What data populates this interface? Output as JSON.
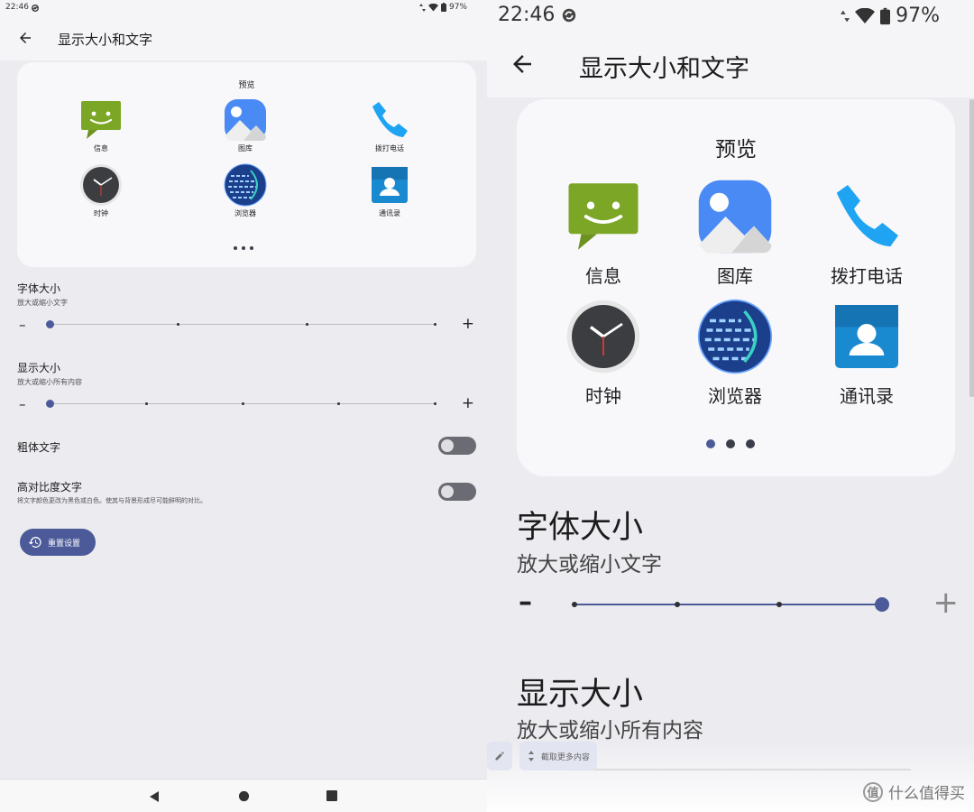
{
  "status": {
    "time": "22:46",
    "battery": "97%"
  },
  "appbar": {
    "title": "显示大小和文字"
  },
  "preview": {
    "title": "预览",
    "apps": [
      {
        "label": "信息",
        "icon": "messages-icon"
      },
      {
        "label": "图库",
        "icon": "gallery-icon"
      },
      {
        "label": "拨打电话",
        "icon": "phone-icon"
      },
      {
        "label": "时钟",
        "icon": "clock-icon"
      },
      {
        "label": "浏览器",
        "icon": "browser-icon"
      },
      {
        "label": "通讯录",
        "icon": "contacts-icon"
      }
    ]
  },
  "font_size": {
    "title": "字体大小",
    "subtitle": "放大或缩小文字",
    "left_level": 0,
    "right_level": 3,
    "steps": 4
  },
  "display_size": {
    "title": "显示大小",
    "subtitle": "放大或缩小所有内容",
    "level": 0,
    "steps": 5
  },
  "bold_text": {
    "title": "粗体文字",
    "on": false
  },
  "high_contrast": {
    "title": "高对比度文字",
    "subtitle": "将文字颜色更改为黑色或白色。使其与背景形成尽可能鲜明的对比。",
    "on": false
  },
  "reset": {
    "label": "重置设置"
  },
  "capture": {
    "label": "截取更多内容"
  },
  "watermark": {
    "text": "什么值得买",
    "logo": "值"
  },
  "colors": {
    "accent": "#4C5A99",
    "background": "#ECEBF0",
    "card": "#F8F7FA"
  }
}
